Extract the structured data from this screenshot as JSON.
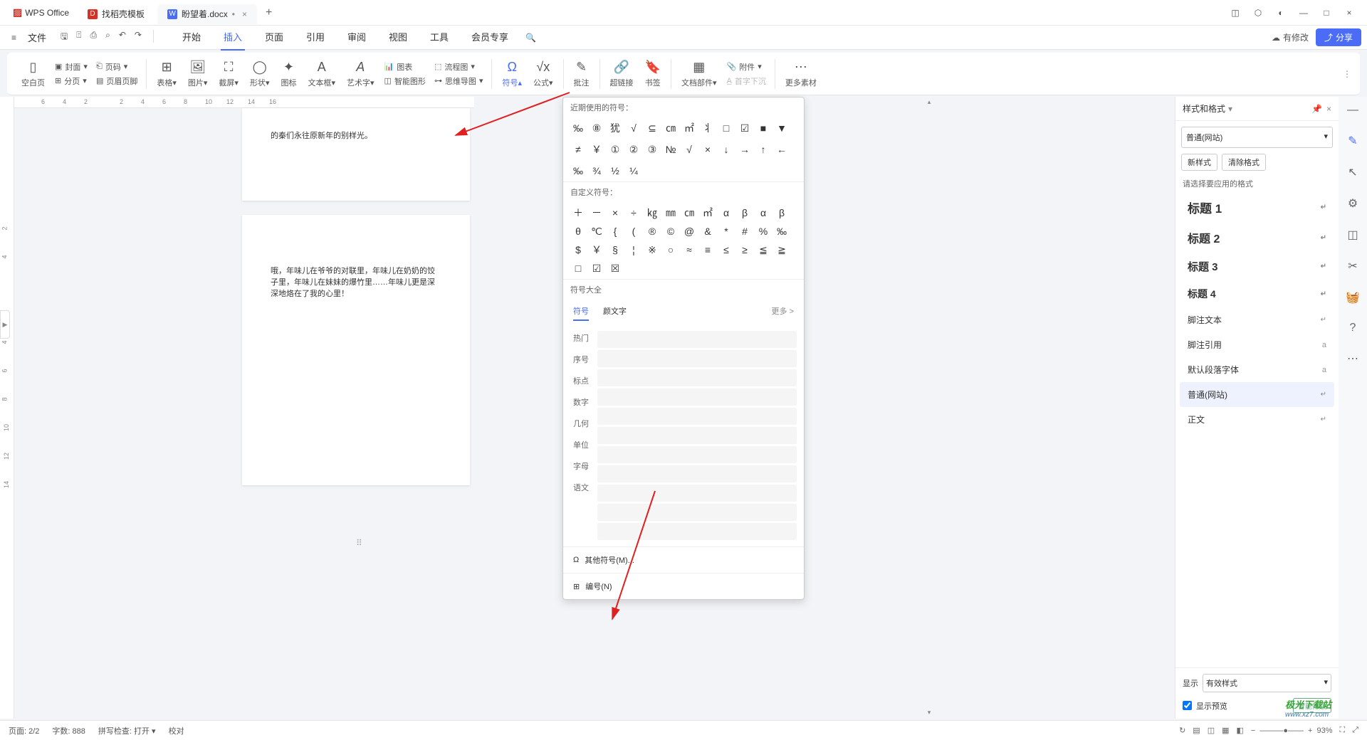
{
  "titlebar": {
    "app_name": "WPS Office",
    "tabs": [
      {
        "icon": "D",
        "label": "找稻壳模板"
      },
      {
        "icon": "W",
        "label": "盼望着.docx",
        "modified": "•",
        "active": true
      }
    ]
  },
  "menubar": {
    "file": "文件",
    "main_tabs": [
      "开始",
      "插入",
      "页面",
      "引用",
      "审阅",
      "视图",
      "工具",
      "会员专享"
    ],
    "active_tab": 1,
    "modified_label": "有修改",
    "share_label": "分享"
  },
  "ribbon": {
    "groups": [
      {
        "label": "空白页"
      },
      {
        "label": "封面"
      },
      {
        "label": "页码"
      },
      {
        "label": "分页"
      },
      {
        "label": "页眉页脚"
      },
      {
        "label": "表格"
      },
      {
        "label": "图片"
      },
      {
        "label": "截屏"
      },
      {
        "label": "形状"
      },
      {
        "label": "图标"
      },
      {
        "label": "文本框"
      },
      {
        "label": "艺术字"
      },
      {
        "label": "图表"
      },
      {
        "label": "智能图形"
      },
      {
        "label": "流程图"
      },
      {
        "label": "思维导图"
      },
      {
        "label": "符号",
        "active": true
      },
      {
        "label": "公式"
      },
      {
        "label": "批注"
      },
      {
        "label": "超链接"
      },
      {
        "label": "书签"
      },
      {
        "label": "文档部件"
      },
      {
        "label": "附件"
      },
      {
        "label": "首字下沉"
      },
      {
        "label": "更多素材"
      }
    ]
  },
  "document": {
    "page1_text": "的秦们永往原新年的别样光。",
    "page2_text": "哦，年味儿在爷爷的对联里，年味儿在奶奶的饺子里，年味儿在妹妹的爆竹里……年味儿更是深深地烙在了我的心里！"
  },
  "symbol_popup": {
    "recent_label": "近期使用的符号：",
    "recent_row1": [
      "‰",
      "⑧",
      "犹",
      "√",
      "⊆",
      "㎝",
      "㎡",
      "丬",
      "□",
      "☑",
      "■",
      "▼"
    ],
    "recent_row2": [
      "≠",
      "￥",
      "①",
      "②",
      "③",
      "№",
      "√",
      "×",
      "↓",
      "→",
      "↑",
      "←"
    ],
    "recent_row3": [
      "‰",
      "¾",
      "½",
      "¼"
    ],
    "custom_label": "自定义符号：",
    "custom_row1": [
      "＋",
      "－",
      "×",
      "÷",
      "㎏",
      "㎜",
      "㎝",
      "㎡",
      "α",
      "β",
      "α",
      "β"
    ],
    "custom_row2": [
      "θ",
      "℃",
      "{",
      "(",
      "®",
      "©",
      "@",
      "&",
      "*",
      "#",
      "%",
      "‰"
    ],
    "custom_row3": [
      "$",
      "￥",
      "§",
      "¦",
      "※",
      "○",
      "≈",
      "≡",
      "≤",
      "≥",
      "≦",
      "≧"
    ],
    "custom_row4": [
      "□",
      "☑",
      "☒"
    ],
    "all_label": "符号大全",
    "tabs": {
      "t1": "符号",
      "t2": "颜文字",
      "more": "更多 >"
    },
    "cats": [
      "热门",
      "序号",
      "标点",
      "数字",
      "几何",
      "单位",
      "字母",
      "语文"
    ],
    "more_symbols": "其他符号(M)...",
    "numbering": "编号(N)"
  },
  "right_panel": {
    "title": "样式和格式",
    "style_name": "普通(网站)",
    "btn_new": "新样式",
    "btn_clear": "清除格式",
    "choose_label": "请选择要应用的格式",
    "items": [
      {
        "label": "标题 1",
        "cls": "h1",
        "tail": "↵"
      },
      {
        "label": "标题 2",
        "cls": "h2",
        "tail": "↵"
      },
      {
        "label": "标题 3",
        "cls": "h3",
        "tail": "↵"
      },
      {
        "label": "标题 4",
        "cls": "h4",
        "tail": "↵"
      },
      {
        "label": "脚注文本",
        "cls": "",
        "tail": "↵"
      },
      {
        "label": "脚注引用",
        "cls": "",
        "tail": "a"
      },
      {
        "label": "默认段落字体",
        "cls": "",
        "tail": "a"
      },
      {
        "label": "普通(网站)",
        "cls": "",
        "tail": "↵",
        "selected": true
      },
      {
        "label": "正文",
        "cls": "",
        "tail": "↵"
      }
    ],
    "show_label": "显示",
    "show_value": "有效样式",
    "preview_label": "显示预览",
    "smart_label": "智能排版"
  },
  "statusbar": {
    "page": "页面: 2/2",
    "words": "字数: 888",
    "spell": "拼写检查: 打开",
    "proof": "校对",
    "zoom": "93%"
  },
  "watermark": {
    "line1": "极光下载站",
    "line2": "www.xz7.com"
  }
}
